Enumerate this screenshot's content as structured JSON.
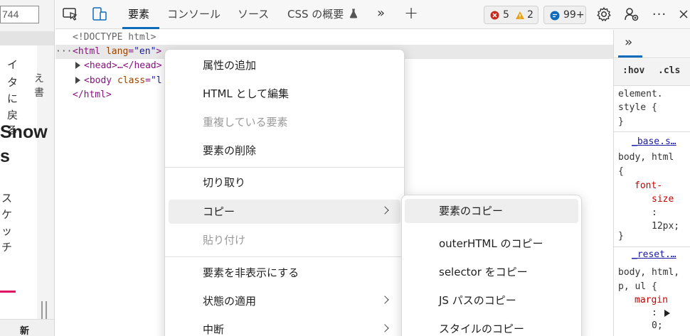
{
  "left_page": {
    "width_value": "744",
    "vertical_chars_a": [
      "イ",
      "タ",
      "に",
      "戻",
      "る"
    ],
    "vertical_chars_b": [
      "ス",
      "ケ",
      "ッ",
      "チ"
    ],
    "right_char": "え",
    "right_char2": "書",
    "headline_1": "Snow",
    "headline_2": "s",
    "bottom_label": "新"
  },
  "toolbar": {
    "tabs": [
      "要素",
      "コンソール",
      "ソース",
      "CSS の概要"
    ],
    "errors": "5",
    "warnings": "2",
    "messages": "99+",
    "accent": "#0f6cbd"
  },
  "dom": {
    "doctype": "<!DOCTYPE html>",
    "dots": "···",
    "html_open": "<html",
    "lang_attr": " lang",
    "lang_eq": "=",
    "lang_val": "\"en\"",
    "html_close_bracket": ">",
    "head": "<head>…</head>",
    "body_open": "<body",
    "class_attr": " class",
    "class_eq": "=",
    "class_val": "\"l",
    "html_end": "</html>"
  },
  "styles": {
    "hov": ":hov",
    "cls": ".cls",
    "element_style_1": "element.",
    "element_style_2": "style {",
    "element_style_3": "}",
    "base_link": "_base.s…",
    "rule1_selector": "body, html",
    "rule1_open": "{",
    "rule1_prop_1": "font-",
    "rule1_prop_2": "size",
    "rule1_colon": ":",
    "rule1_value": "12px;",
    "rule1_close": "}",
    "reset_link": "_reset.…",
    "rule2_selector_1": "body, html,",
    "rule2_selector_2": "p, ul {",
    "rule2_prop": "margin",
    "rule2_colon": ":",
    "rule2_value": "0;"
  },
  "context_menu": {
    "items": [
      {
        "label": "属性の追加",
        "disabled": false
      },
      {
        "label": "HTML として編集",
        "disabled": false
      },
      {
        "label": "重複している要素",
        "disabled": true
      },
      {
        "label": "要素の削除",
        "disabled": false
      },
      {
        "label": "切り取り",
        "disabled": false
      },
      {
        "label": "コピー",
        "disabled": false,
        "submenu": true
      },
      {
        "label": "貼り付け",
        "disabled": true
      },
      {
        "label": "要素を非表示にする",
        "disabled": false
      },
      {
        "label": "状態の適用",
        "disabled": false,
        "submenu": true
      },
      {
        "label": "中断",
        "disabled": false,
        "submenu": true
      }
    ]
  },
  "copy_submenu": {
    "items": [
      "要素のコピー",
      "outerHTML のコピー",
      "selector をコピー",
      "JS パスのコピー",
      "スタイルのコピー"
    ]
  }
}
